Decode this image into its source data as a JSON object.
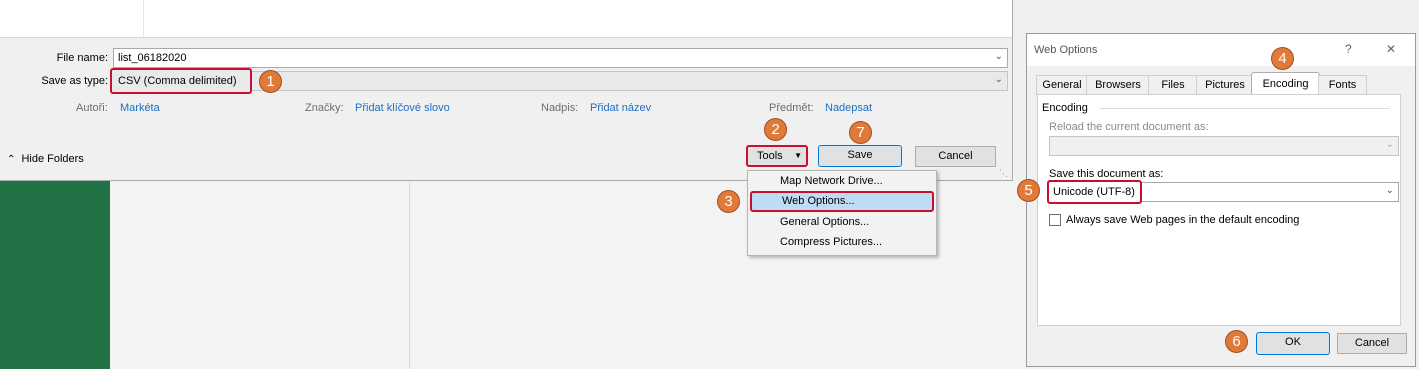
{
  "save_dialog": {
    "file_name_label": "File name:",
    "file_name_value": "list_06182020",
    "save_as_type_label": "Save as type:",
    "save_as_type_value": "CSV (Comma delimited)",
    "meta": {
      "authors_label": "Autoři:",
      "authors_value": "Markéta",
      "tags_label": "Značky:",
      "tags_value": "Přidat klíčové slovo",
      "title_label": "Nadpis:",
      "title_value": "Přidat název",
      "subject_label": "Předmět:",
      "subject_value": "Nadepsat"
    },
    "hide_folders_label": "Hide Folders",
    "tools_label": "Tools",
    "save_label": "Save",
    "cancel_label": "Cancel"
  },
  "tools_menu": {
    "items": [
      "Map Network Drive...",
      "Web Options...",
      "General Options...",
      "Compress Pictures..."
    ]
  },
  "web_options": {
    "title": "Web Options",
    "help_glyph": "?",
    "close_glyph": "✕",
    "tabs": [
      "General",
      "Browsers",
      "Files",
      "Pictures",
      "Encoding",
      "Fonts"
    ],
    "active_tab": "Encoding",
    "section_label": "Encoding",
    "reload_label": "Reload the current document as:",
    "reload_value": "",
    "save_doc_label": "Save this document as:",
    "save_doc_value": "Unicode (UTF-8)",
    "always_save_label": "Always save Web pages in the default encoding",
    "always_save_checked": false,
    "ok_label": "OK",
    "cancel_label": "Cancel"
  },
  "steps": [
    "1",
    "2",
    "3",
    "4",
    "5",
    "6",
    "7"
  ],
  "colors": {
    "highlight_red": "#c8102e",
    "badge_orange": "#e07a3a",
    "link_blue": "#1f6fc1",
    "excel_green": "#217346"
  }
}
